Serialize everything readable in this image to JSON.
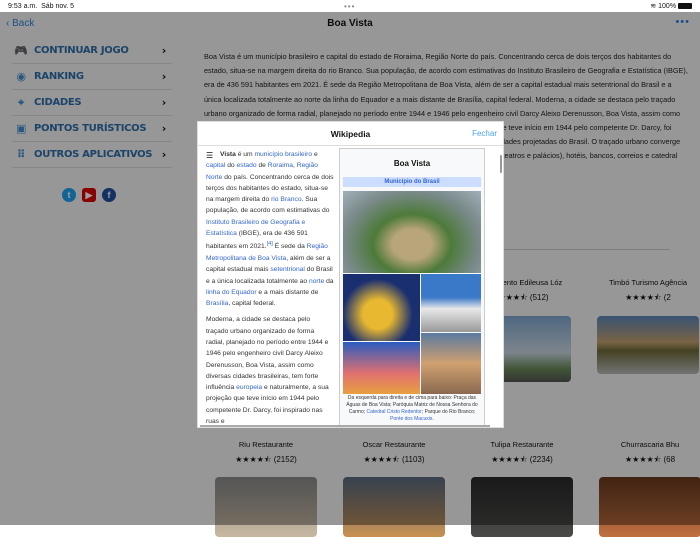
{
  "status": {
    "time": "9:53 a.m.",
    "date": "Sáb nov. 5",
    "battery": "100%"
  },
  "nav": {
    "back": "Back",
    "title": "Boa Vista"
  },
  "menu": [
    {
      "icon": "gamepad-icon",
      "glyph": "🎮",
      "label": "CONTINUAR JOGO"
    },
    {
      "icon": "globe-icon",
      "glyph": "◉",
      "label": "RANKING"
    },
    {
      "icon": "crosshair-icon",
      "glyph": "⌖",
      "label": "CIDADES"
    },
    {
      "icon": "image-icon",
      "glyph": "▣",
      "label": "PONTOS TURÍSTICOS"
    },
    {
      "icon": "grid-icon",
      "glyph": "⠿",
      "label": "OUTROS APLICATIVOS"
    }
  ],
  "main_text": "Boa Vista é um município brasileiro e capital do estado de Roraima, Região Norte do país. Concentrando cerca de dois terços dos habitantes do estado, situa-se na margem direita do rio Branco. Sua população, de acordo com estimativas do Instituto Brasileiro de Geografia e Estatística (IBGE), era de 436 591 habitantes em 2021. É sede da Região Metropolitana de Boa Vista, além de ser a capital estadual mais setentrional do Brasil e a única localizada totalmente ao norte da linha do Equador e a mais distante de Brasília, capital federal. Moderna, a cidade se destaca pelo traçado urbano organizado de forma radial, planejado no período entre 1944 e 1946 pelo engenheiro civil Darcy Aleixo Derenusson, Boa Vista, assim como diversas cidades brasileiras, tem forte influência europeia e naturalmente, a sua projeção que teve início em 1944 pelo competente Dr. Darcy, foi inspirado nas ruas e avenidas de Paris, transformando-se também em uma das primeiras cidades projetadas do Brasil. O traçado urbano converge para o Centro Cívico Joaquim Nabuco, onde se concentram os principais edifícios públicos (teatros e palácios), hotéis, bancos, correios e catedral",
  "places_top": [
    {
      "name": "Monumento Edileusa Lóz",
      "rating": "(512)"
    },
    {
      "name": "Timbó Turismo Agência",
      "rating": "(2"
    }
  ],
  "restaurants": [
    {
      "name": "Riu Restaurante",
      "rating": "(2152)",
      "stars": "★★★★⯪"
    },
    {
      "name": "Oscar Restaurante",
      "rating": "(1103)",
      "stars": "★★★★⯪"
    },
    {
      "name": "Tulipa Restaurante",
      "rating": "(2234)",
      "stars": "★★★★⯪"
    },
    {
      "name": "Churrascaria Bhu",
      "rating": "(68",
      "stars": "★★★★⯪"
    }
  ],
  "modal": {
    "title": "Wikipedia",
    "close": "Fechar",
    "infobox_title": "Boa Vista",
    "infobox_sub": "Município do Brasil",
    "caption": "Da esquerda para direita e de cima para baixo: Praça das Águas de Boa Vista; Paróquia Matriz de Nossa Senhora do Carmo;",
    "caption_link1": "Catedral Cristo Redentor",
    "caption_mid": "; Parque do Rio Branco;",
    "caption_link2": "Ponte dos Macuxis",
    "p2": "Moderna, a cidade se destaca pelo traçado urbano organizado de forma radial, planejado no período entre 1944 e 1946 pelo engenheiro civil Darcy Aleixo Derenusson, Boa Vista, assim como diversas cidades brasileiras, tem forte influência",
    "p2_link": "europeia",
    "p2_end": " e naturalmente, a sua projeção que teve início em 1944 pelo competente Dr. Darcy, foi inspirado nas ruas e"
  },
  "stars": "★★★★⯪"
}
